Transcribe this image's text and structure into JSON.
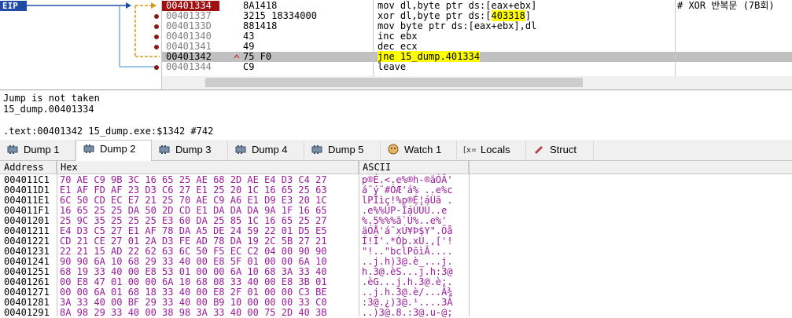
{
  "disasm": {
    "eip_label": "EIP",
    "rows": [
      {
        "addr": "00401334",
        "bytes": "8A1418",
        "asm": "mov dl,byte ptr ds:[eax+ebx]",
        "asm_pre": "",
        "asm_hl": "",
        "asm_post": "",
        "comment": "# XOR 반복문 (7B회)",
        "current": true,
        "selected": false
      },
      {
        "addr": "00401337",
        "bytes": "3215 18334000",
        "asm": "",
        "asm_pre": "xor dl,byte ptr ds:[",
        "asm_hl": "403318",
        "asm_post": "]",
        "comment": "",
        "current": false,
        "selected": false
      },
      {
        "addr": "0040133D",
        "bytes": "881418",
        "asm": "mov byte ptr ds:[eax+ebx],dl",
        "asm_pre": "",
        "asm_hl": "",
        "asm_post": "",
        "comment": "",
        "current": false,
        "selected": false
      },
      {
        "addr": "00401340",
        "bytes": "43",
        "asm": "inc ebx",
        "asm_pre": "",
        "asm_hl": "",
        "asm_post": "",
        "comment": "",
        "current": false,
        "selected": false
      },
      {
        "addr": "00401341",
        "bytes": "49",
        "asm": "dec ecx",
        "asm_pre": "",
        "asm_hl": "",
        "asm_post": "",
        "comment": "",
        "current": false,
        "selected": false
      },
      {
        "addr": "00401342",
        "bytes": "75 F0",
        "asm": "",
        "asm_pre": "",
        "asm_hl": "jne 15_dump.401334",
        "asm_post": "",
        "comment": "",
        "current": false,
        "selected": true
      },
      {
        "addr": "00401344",
        "bytes": "C9",
        "asm": "leave",
        "asm_pre": "",
        "asm_hl": "",
        "asm_post": "",
        "comment": "",
        "current": false,
        "selected": false
      }
    ]
  },
  "info": {
    "line1": "Jump is not taken",
    "line2": "15_dump.00401334",
    "line3": ".text:00401342 15_dump.exe:$1342 #742"
  },
  "tabs": [
    {
      "label": "Dump 1",
      "icon": "memory-icon",
      "active": false
    },
    {
      "label": "Dump 2",
      "icon": "memory-icon",
      "active": true
    },
    {
      "label": "Dump 3",
      "icon": "memory-icon",
      "active": false
    },
    {
      "label": "Dump 4",
      "icon": "memory-icon",
      "active": false
    },
    {
      "label": "Dump 5",
      "icon": "memory-icon",
      "active": false
    },
    {
      "label": "Watch 1",
      "icon": "watch-icon",
      "active": false
    },
    {
      "label": "Locals",
      "icon": "locals-icon",
      "active": false
    },
    {
      "label": "Struct",
      "icon": "struct-icon",
      "active": false
    }
  ],
  "dump": {
    "headers": {
      "address": "Address",
      "hex": "Hex",
      "ascii": "ASCII"
    },
    "rows": [
      {
        "addr": "004011C1",
        "hex": "70 AE C9 9B 3C 16 65 25 AE 68 2D AE E4 D3 C4 27",
        "ascii": "p®É.<.e%®h-®äÓÄ'"
      },
      {
        "addr": "004011D1",
        "hex": "E1 AF FD AF 23 D3 C6 27 E1 25 20 1C 16 65 25 63",
        "ascii": "á¯ý¯#ÓÆ'á% ..e%c"
      },
      {
        "addr": "004011E1",
        "hex": "6C 50 CD EC E7 21 25 70 AE C9 A6 E1 D9 E3 20 1C",
        "ascii": "lPÍìç!%p®É¦áÙã ."
      },
      {
        "addr": "004011F1",
        "hex": "16 65 25 25 DA 50 2D CD E1 DA DA DA 9A 1F 16 65",
        "ascii": ".e%%ÚP-ÍáÚÚÚ..e"
      },
      {
        "addr": "00401201",
        "hex": "25 9C 35 25 25 25 E3 60 DA 25 85 1C 16 65 25 27",
        "ascii": "%.5%%%ã`Ú%..e%'"
      },
      {
        "addr": "00401211",
        "hex": "E4 D3 C5 27 E1 AF 78 DA A5 DE 24 59 22 01 D5 E5",
        "ascii": "äÓÅ'á¯xÚ¥Þ$Y\".Õå"
      },
      {
        "addr": "00401221",
        "hex": "CD 21 CE 27 01 2A D3 FE AD 78 DA 19 2C 5B 27 21",
        "ascii": "Í!Î'.*Óþ.xÚ.,['!"
      },
      {
        "addr": "00401231",
        "hex": "22 21 15 AD 22 62 63 6C 50 F5 EC C2 04 00 90 90",
        "ascii": "\"!..\"bclPõìÂ...."
      },
      {
        "addr": "00401241",
        "hex": "90 90 6A 10 68 29 33 40 00 E8 5F 01 00 00 6A 10",
        "ascii": "..j.h)3@.è_...j."
      },
      {
        "addr": "00401251",
        "hex": "68 19 33 40 00 E8 53 01 00 00 6A 10 68 3A 33 40",
        "ascii": "h.3@.èS...j.h:3@"
      },
      {
        "addr": "00401261",
        "hex": "00 E8 47 01 00 00 6A 10 68 08 33 40 00 E8 3B 01",
        "ascii": ".èG...j.h.3@.è;."
      },
      {
        "addr": "00401271",
        "hex": "00 00 6A 01 68 18 33 40 00 E8 2F 01 00 00 C3 BE",
        "ascii": "..j.h.3@.è/...Ã¾"
      },
      {
        "addr": "00401281",
        "hex": "3A 33 40 00 BF 29 33 40 00 B9 10 00 00 00 33 C0",
        "ascii": ":3@.¿)3@.¹....3À"
      },
      {
        "addr": "00401291",
        "hex": "8A 98 29 33 40 00 38 98 3A 33 40 00 75 2D 40 3B",
        "ascii": "..)3@.8.:3@.u-@;"
      }
    ]
  },
  "colors": {
    "eip": "#1f4ba5",
    "current_addr": "#a01010",
    "highlight": "#ffff00",
    "selected_row": "#c0c0c0",
    "ascii_text": "#9b1c9b"
  }
}
